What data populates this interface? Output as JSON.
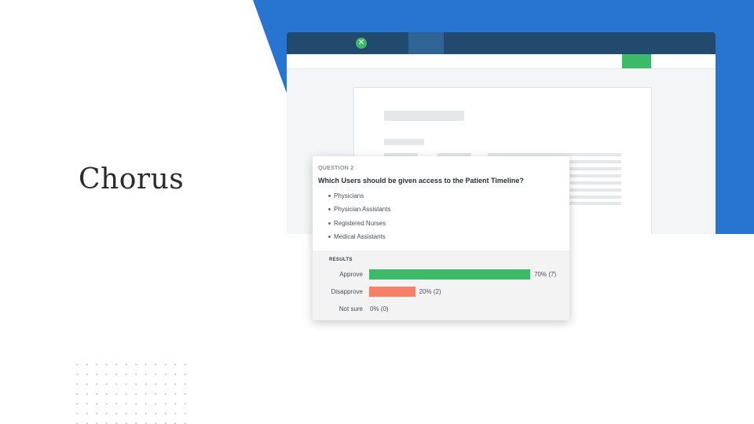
{
  "slide": {
    "title": "Chorus",
    "accent_color": "#2874d1"
  },
  "app": {
    "nav_color": "#22496e",
    "active_tab_color": "#2f6495",
    "button_color": "#3cba6a",
    "logo_icon": "chorus-logo-icon"
  },
  "poll": {
    "question_label": "QUESTION 2",
    "question": "Which Users should be given access to the Patient Timeline?",
    "options": [
      "Physicians",
      "Physician Assistants",
      "Registered Nurses",
      "Medical Assistants"
    ],
    "results_label": "RESULTS",
    "results": [
      {
        "label": "Approve",
        "percent": 70,
        "value_text": "70% (7)",
        "color": "#3cba6a"
      },
      {
        "label": "Disapprove",
        "percent": 20,
        "value_text": "20% (2)",
        "color": "#f58168"
      },
      {
        "label": "Not sure",
        "percent": 0,
        "value_text": "0% (0)",
        "color": "#cccccc"
      }
    ]
  }
}
